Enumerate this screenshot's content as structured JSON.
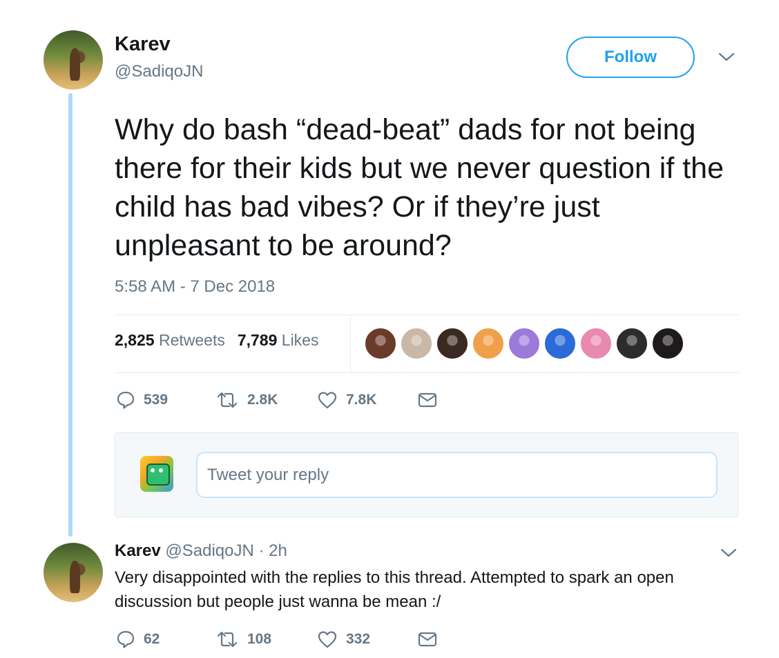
{
  "tweet": {
    "author_name": "Karev",
    "author_handle": "@SadiqoJN",
    "follow_label": "Follow",
    "text": "Why do bash “dead-beat” dads for not being there for their kids but we never question if the child has bad vibes? Or if they’re just unpleasant to be around?",
    "timestamp": "5:58 AM - 7 Dec 2018",
    "retweets_count": "2,825",
    "retweets_label": "Retweets",
    "likes_count": "7,789",
    "likes_label": "Likes",
    "actions": {
      "replies": "539",
      "retweets": "2.8K",
      "likes": "7.8K"
    }
  },
  "liker_avatars": [
    {
      "color": "#6b3b2a"
    },
    {
      "color": "#c9b8a8"
    },
    {
      "color": "#3a2a22"
    },
    {
      "color": "#f0a04a"
    },
    {
      "color": "#9b7ad8"
    },
    {
      "color": "#2a6bd8"
    },
    {
      "color": "#e889b0"
    },
    {
      "color": "#2c2c2c"
    },
    {
      "color": "#1e1a1a"
    }
  ],
  "composer": {
    "placeholder": "Tweet your reply"
  },
  "reply": {
    "author_name": "Karev",
    "author_handle": "@SadiqoJN",
    "time": "· 2h",
    "text": "Very disappointed with the replies to this thread. Attempted to spark an open discussion but people just wanna be mean :/",
    "actions": {
      "replies": "62",
      "retweets": "108",
      "likes": "332"
    }
  },
  "colors": {
    "accent": "#1da1f2",
    "muted": "#657786",
    "thread_line": "#aed9f7"
  },
  "icons": [
    "reply-icon",
    "retweet-icon",
    "like-icon",
    "dm-icon",
    "chevron-down-icon"
  ]
}
